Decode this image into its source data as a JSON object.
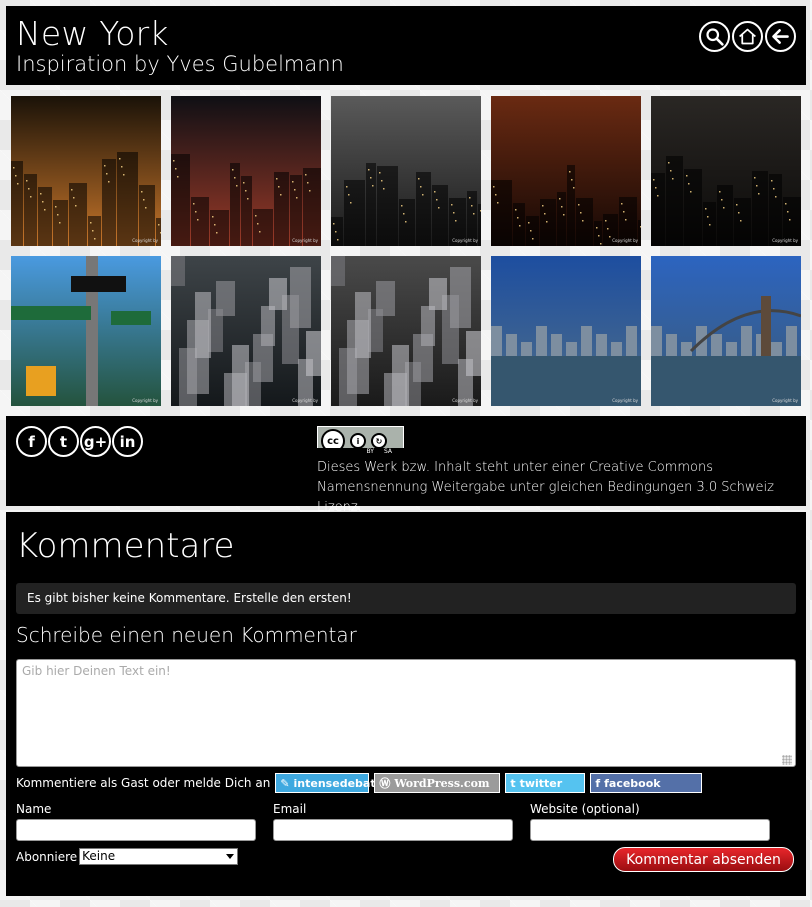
{
  "header": {
    "title": "New York",
    "subtitle": "Inspiration by Yves Gubelmann",
    "icons": [
      "search-icon",
      "home-icon",
      "back-arrow-icon"
    ]
  },
  "gallery": {
    "copyright_label": "Copyright by",
    "photos": [
      {
        "name": "times-square-taxis",
        "colors": [
          "#1a1208",
          "#c8762a"
        ]
      },
      {
        "name": "times-square-crowd",
        "colors": [
          "#0f0f14",
          "#9b3a28"
        ]
      },
      {
        "name": "skyline-gray-night",
        "colors": [
          "#5a5a5a",
          "#1a1a1a"
        ]
      },
      {
        "name": "skyline-orange-night",
        "colors": [
          "#6a2a12",
          "#150805"
        ]
      },
      {
        "name": "skyline-dark-night",
        "colors": [
          "#2a2724",
          "#0b0a09"
        ]
      },
      {
        "name": "broadway-street-signs",
        "colors": [
          "#4a9ae0",
          "#24533d"
        ]
      },
      {
        "name": "aerial-buildings-gray",
        "colors": [
          "#3e4448",
          "#14181b"
        ]
      },
      {
        "name": "aerial-buildings-bw",
        "colors": [
          "#4a4a4a",
          "#1a1a1a"
        ]
      },
      {
        "name": "skyline-waterfront",
        "colors": [
          "#1d4ea0",
          "#4f6e88"
        ]
      },
      {
        "name": "brooklyn-bridge",
        "colors": [
          "#2c64c0",
          "#3c5a74"
        ]
      }
    ]
  },
  "social": {
    "icons": [
      {
        "name": "facebook-icon",
        "glyph": "f"
      },
      {
        "name": "twitter-icon",
        "glyph": "t"
      },
      {
        "name": "googleplus-icon",
        "glyph": "g+"
      },
      {
        "name": "linkedin-icon",
        "glyph": "in"
      }
    ]
  },
  "license": {
    "badge_cc": "cc",
    "badge_by": "BY",
    "badge_sa": "SA",
    "text": "Dieses Werk bzw. Inhalt steht unter einer Creative Commons Namensnennung Weitergabe unter gleichen Bedingungen 3.0 Schweiz Lizenz."
  },
  "comments": {
    "heading": "Kommentare",
    "empty_notice": "Es gibt bisher keine Kommentare. Erstelle den ersten!",
    "new_heading": "Schreibe einen neuen Kommentar",
    "textarea_placeholder": "Gib hier Deinen Text ein!",
    "guest_prompt": "Kommentiere als Gast oder melde Dich an",
    "login_services": {
      "intensedebate": "intensedebate",
      "wordpress": "WordPress.com",
      "twitter": "twitter",
      "facebook": "facebook"
    },
    "fields": {
      "name": "Name",
      "email": "Email",
      "website": "Website (optional)"
    },
    "subscribe_label": "Abonniere",
    "subscribe_value": "Keine",
    "submit_label": "Kommentar absenden"
  }
}
